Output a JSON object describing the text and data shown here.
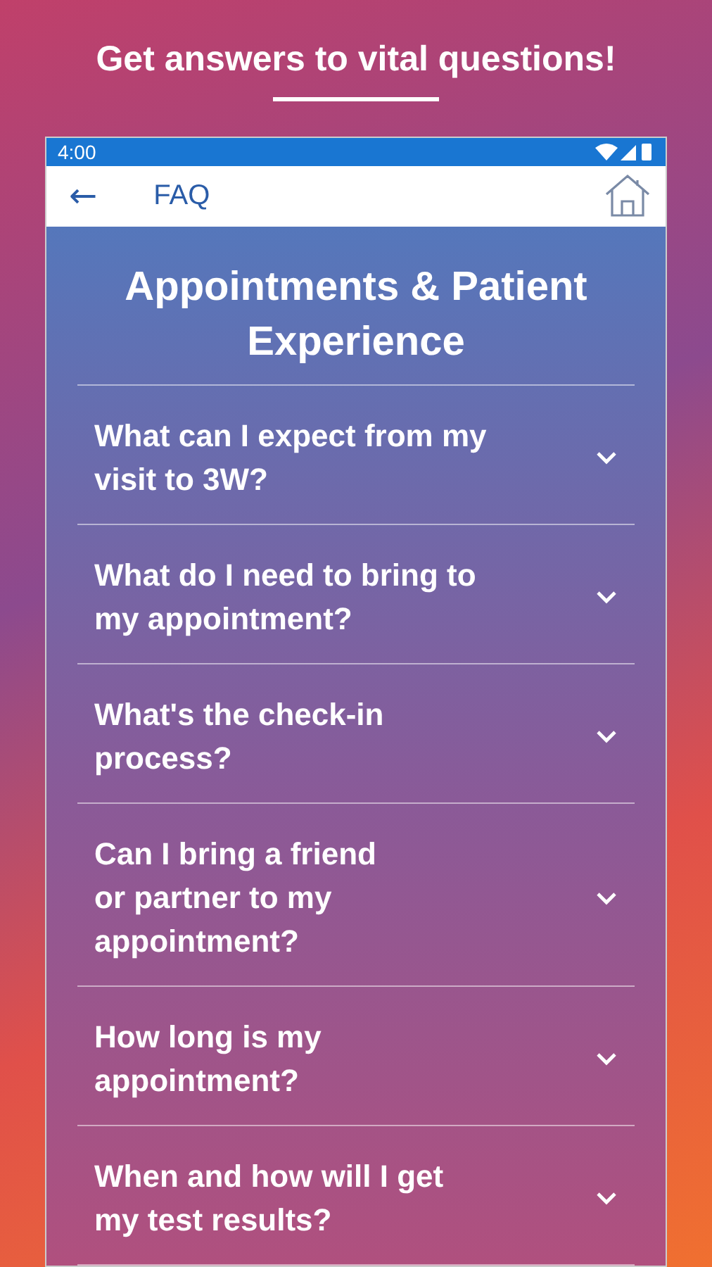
{
  "headline": "Get answers to vital questions!",
  "status_bar": {
    "time": "4:00"
  },
  "app_bar": {
    "back": "←",
    "title": "FAQ"
  },
  "section_title": "Appointments & Patient Experience",
  "questions": [
    {
      "text": "What can I expect from my\nvisit to 3W?",
      "expanded": false
    },
    {
      "text": "What do I need to bring to\nmy appointment?",
      "expanded": false
    },
    {
      "text": "What's the check-in\nprocess?",
      "expanded": false
    },
    {
      "text": "Can I bring a friend\nor partner to my\nappointment?",
      "expanded": false
    },
    {
      "text": "How long is my\nappointment?",
      "expanded": false
    },
    {
      "text": "When and how will I get\nmy test results?",
      "expanded": false
    }
  ]
}
